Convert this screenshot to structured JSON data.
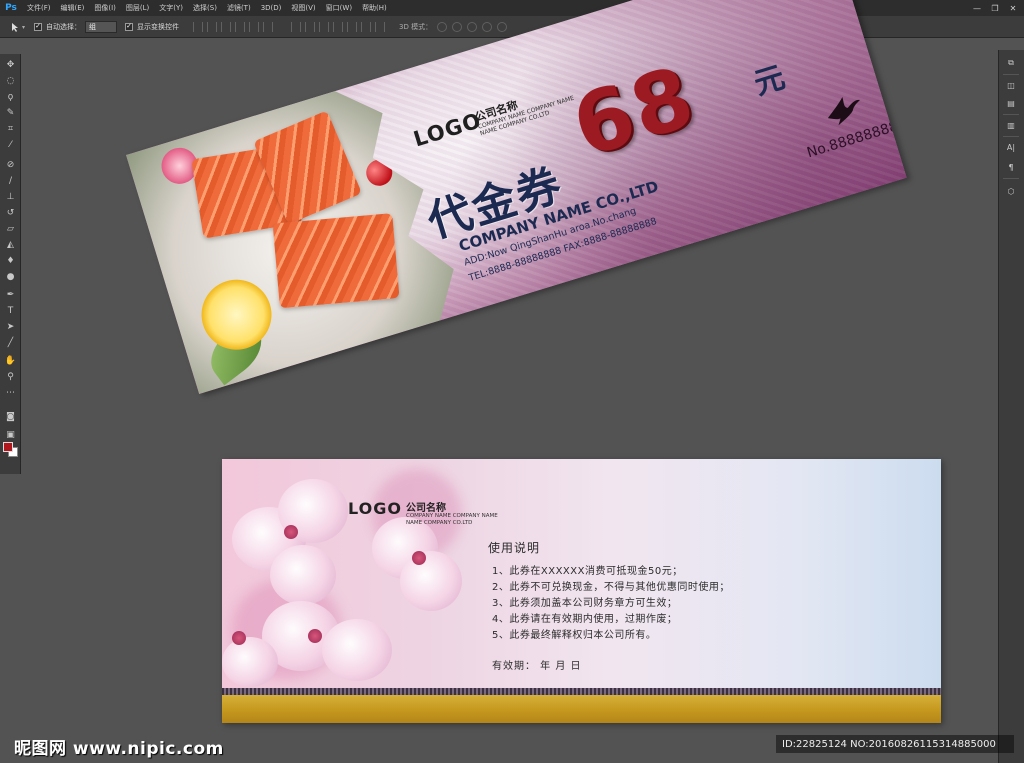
{
  "app": {
    "logo": "Ps",
    "menu": [
      "文件(F)",
      "编辑(E)",
      "图像(I)",
      "图层(L)",
      "文字(Y)",
      "选择(S)",
      "滤镜(T)",
      "3D(D)",
      "视图(V)",
      "窗口(W)",
      "帮助(H)"
    ],
    "window_controls": [
      "—",
      "❐",
      "✕"
    ]
  },
  "options_bar": {
    "auto_select_label": "自动选择：",
    "auto_select_value": "组",
    "show_transform_label": "显示变换控件",
    "mode_3d_label": "3D 模式："
  },
  "front": {
    "logo": "LOGO",
    "company_cn": "公司名称",
    "company_en_1": "COMPANY NAME COMPANY NAME",
    "company_en_2": "NAME COMPANY CO.LTD",
    "title": "代金券",
    "amount": "68",
    "currency": "元",
    "company_name": "COMPANY NAME CO.,LTD",
    "address": "ADD:Now QingShanHu aroa.No.chang",
    "phone_fax": "TEL:8888-88888888   FAX:8888-88888888",
    "serial": "No.88888888"
  },
  "back": {
    "logo": "LOGO",
    "company_cn": "公司名称",
    "company_en_1": "COMPANY NAME COMPANY NAME",
    "company_en_2": "NAME COMPANY CO.LTD",
    "instructions_title": "使用说明",
    "instructions": [
      "1、此券在XXXXXX消费可抵现金50元；",
      "2、此券不可兑换现金，不得与其他优惠同时使用；",
      "3、此券须加盖本公司财务章方可生效；",
      "4、此券请在有效期内使用，过期作废；",
      "5、此券最终解释权归本公司所有。"
    ],
    "validity": "有效期：         年    月    日"
  },
  "watermark": {
    "site": "昵图网 www.nipic.com",
    "id_text": "ID:22825124 NO:20160826115314885000"
  },
  "colors": {
    "amount_red": "#9c1b22",
    "navy_text": "#1c2a52",
    "gold_strip": "#c79a1f",
    "foreground_color": "#b1161c",
    "background_color": "#ffffff"
  },
  "icons": {
    "left_toolbar": [
      "move-icon",
      "marquee-icon",
      "lasso-icon",
      "quick-select-icon",
      "crop-icon",
      "eyedropper-icon",
      "healing-icon",
      "brush-icon",
      "stamp-icon",
      "history-brush-icon",
      "eraser-icon",
      "gradient-icon",
      "blur-icon",
      "dodge-icon",
      "pen-icon",
      "type-icon",
      "path-select-icon",
      "shape-icon",
      "hand-icon",
      "zoom-icon"
    ],
    "right_panel": [
      "history-panel-icon",
      "layers-panel-icon",
      "adjust-panel-icon",
      "brush-panel-icon",
      "character-panel-icon",
      "paragraph-panel-icon",
      "3d-panel-icon"
    ]
  }
}
